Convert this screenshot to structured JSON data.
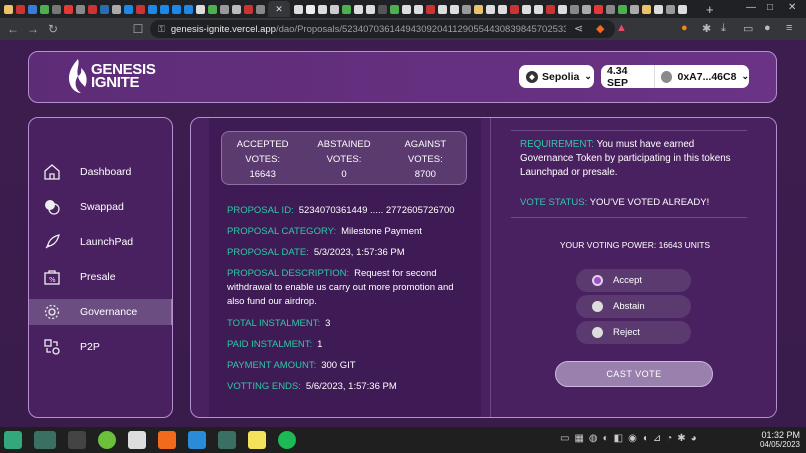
{
  "browser": {
    "url_host": "genesis-ignite.vercel.app",
    "url_path": "/dao/Proposals/523407036144943092041129055443083984570253302…"
  },
  "header": {
    "logo_line1": "GENESIS",
    "logo_line2": "IGNITE",
    "network_label": "Sepolia",
    "balance": "4.34 SEP",
    "account": "0xA7...46C8"
  },
  "sidebar": {
    "items": [
      {
        "label": "Dashboard",
        "icon": "home-icon"
      },
      {
        "label": "Swappad",
        "icon": "swap-icon"
      },
      {
        "label": "LaunchPad",
        "icon": "rocket-icon"
      },
      {
        "label": "Presale",
        "icon": "presale-icon"
      },
      {
        "label": "Governance",
        "icon": "governance-icon",
        "active": true
      },
      {
        "label": "P2P",
        "icon": "p2p-icon"
      }
    ]
  },
  "votes": {
    "accepted_label": "ACCEPTED VOTES:",
    "accepted_value": "16643",
    "abstained_label": "ABSTAINED VOTES:",
    "abstained_value": "0",
    "against_label": "AGAINST VOTES:",
    "against_value": "8700"
  },
  "proposal": {
    "id_label": "PROPOSAL ID:",
    "id_value": "5234070361449 ..... 2772605726700",
    "category_label": "PROPOSAL CATEGORY:",
    "category_value": "Milestone Payment",
    "date_label": "PROPOSAL DATE:",
    "date_value": "5/3/2023, 1:57:36 PM",
    "description_label": "PROPOSAL DESCRIPTION:",
    "description_value": "Request for second withdrawal to enable us carry out more promotion and also fund our airdrop.",
    "total_label": "TOTAL INSTALMENT:",
    "total_value": "3",
    "paid_label": "PAID INSTALMENT:",
    "paid_value": "1",
    "payment_label": "PAYMENT AMOUNT:",
    "payment_value": "300 GIT",
    "ends_label": "VOTTING ENDS:",
    "ends_value": "5/6/2023, 1:57:36 PM"
  },
  "voting": {
    "requirement_label": "REQUIREMENT:",
    "requirement_text": "You must have earned Governance Token by participating in this tokens Launchpad or presale.",
    "status_label": "VOTE STATUS:",
    "status_value": "YOU'VE VOTED ALREADY!",
    "power": "YOUR VOTING POWER: 16643 UNITS",
    "options": [
      {
        "label": "Accept",
        "selected": true
      },
      {
        "label": "Abstain",
        "selected": false
      },
      {
        "label": "Reject",
        "selected": false
      }
    ],
    "cast_label": "CAST VOTE"
  },
  "taskbar": {
    "time": "01:32 PM",
    "date": "04/05/2023"
  },
  "colors": {
    "accent_teal": "#2ec8a6",
    "panel_purple": "#4a2160",
    "border": "#b58fcf"
  }
}
